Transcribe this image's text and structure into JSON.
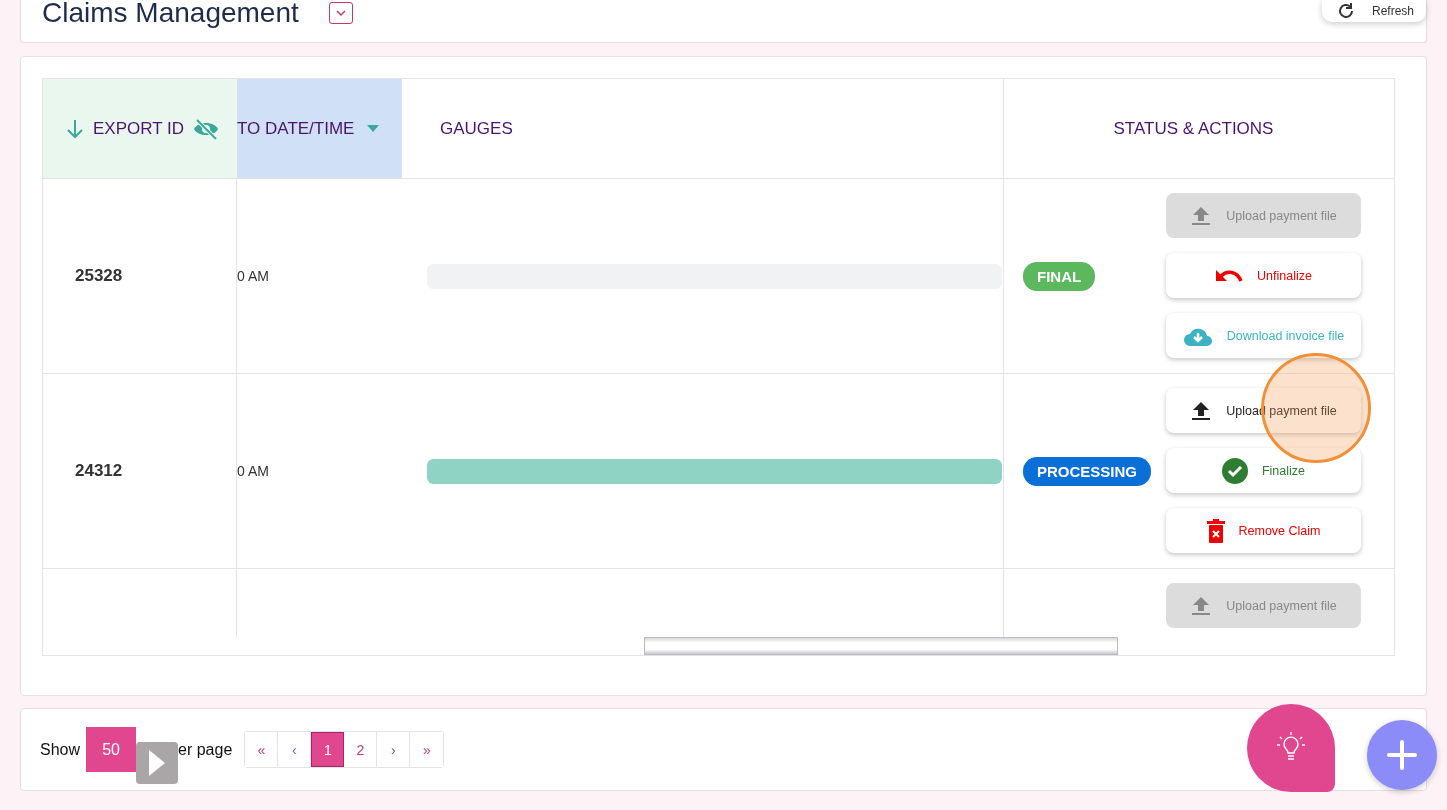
{
  "header": {
    "title": "Claims Management",
    "refresh_label": "Refresh"
  },
  "table": {
    "columns": [
      {
        "label": "EXPORT ID",
        "kind": "export"
      },
      {
        "label": "TO DATE/TIME",
        "kind": "date"
      },
      {
        "label": "GAUGES",
        "kind": "gauge"
      },
      {
        "label": "STATUS & ACTIONS",
        "kind": "status"
      }
    ],
    "rows": [
      {
        "export_id": "25328",
        "date": "0 AM",
        "gauge": {
          "level": 0
        },
        "status": {
          "label": "FINAL",
          "color": "#5cb85c"
        },
        "actions": [
          {
            "kind": "upload",
            "label": "Upload payment file",
            "disabled": true
          },
          {
            "kind": "unfinalize",
            "label": "Unfinalize",
            "disabled": false
          },
          {
            "kind": "download",
            "label": "Download invoice file",
            "disabled": false
          }
        ]
      },
      {
        "export_id": "24312",
        "date": "0 AM",
        "gauge": {
          "level": 1
        },
        "status": {
          "label": "PROCESSING",
          "color": "#0a6fd6"
        },
        "actions": [
          {
            "kind": "upload",
            "label": "Upload payment file",
            "disabled": false
          },
          {
            "kind": "finalize",
            "label": "Finalize",
            "disabled": false
          },
          {
            "kind": "remove",
            "label": "Remove Claim",
            "disabled": false
          }
        ]
      },
      {
        "export_id": "",
        "date": "",
        "gauge": null,
        "status": null,
        "actions": [
          {
            "kind": "upload",
            "label": "Upload payment file",
            "disabled": true
          }
        ]
      }
    ]
  },
  "pagination": {
    "show_label": "Show",
    "page_size": "50",
    "per_page_label": "er page",
    "pages": [
      {
        "label": "«",
        "selected": false
      },
      {
        "label": "‹",
        "selected": false
      },
      {
        "label": "1",
        "selected": true
      },
      {
        "label": "2",
        "selected": false
      },
      {
        "label": "›",
        "selected": false
      },
      {
        "label": "»",
        "selected": false
      }
    ]
  }
}
